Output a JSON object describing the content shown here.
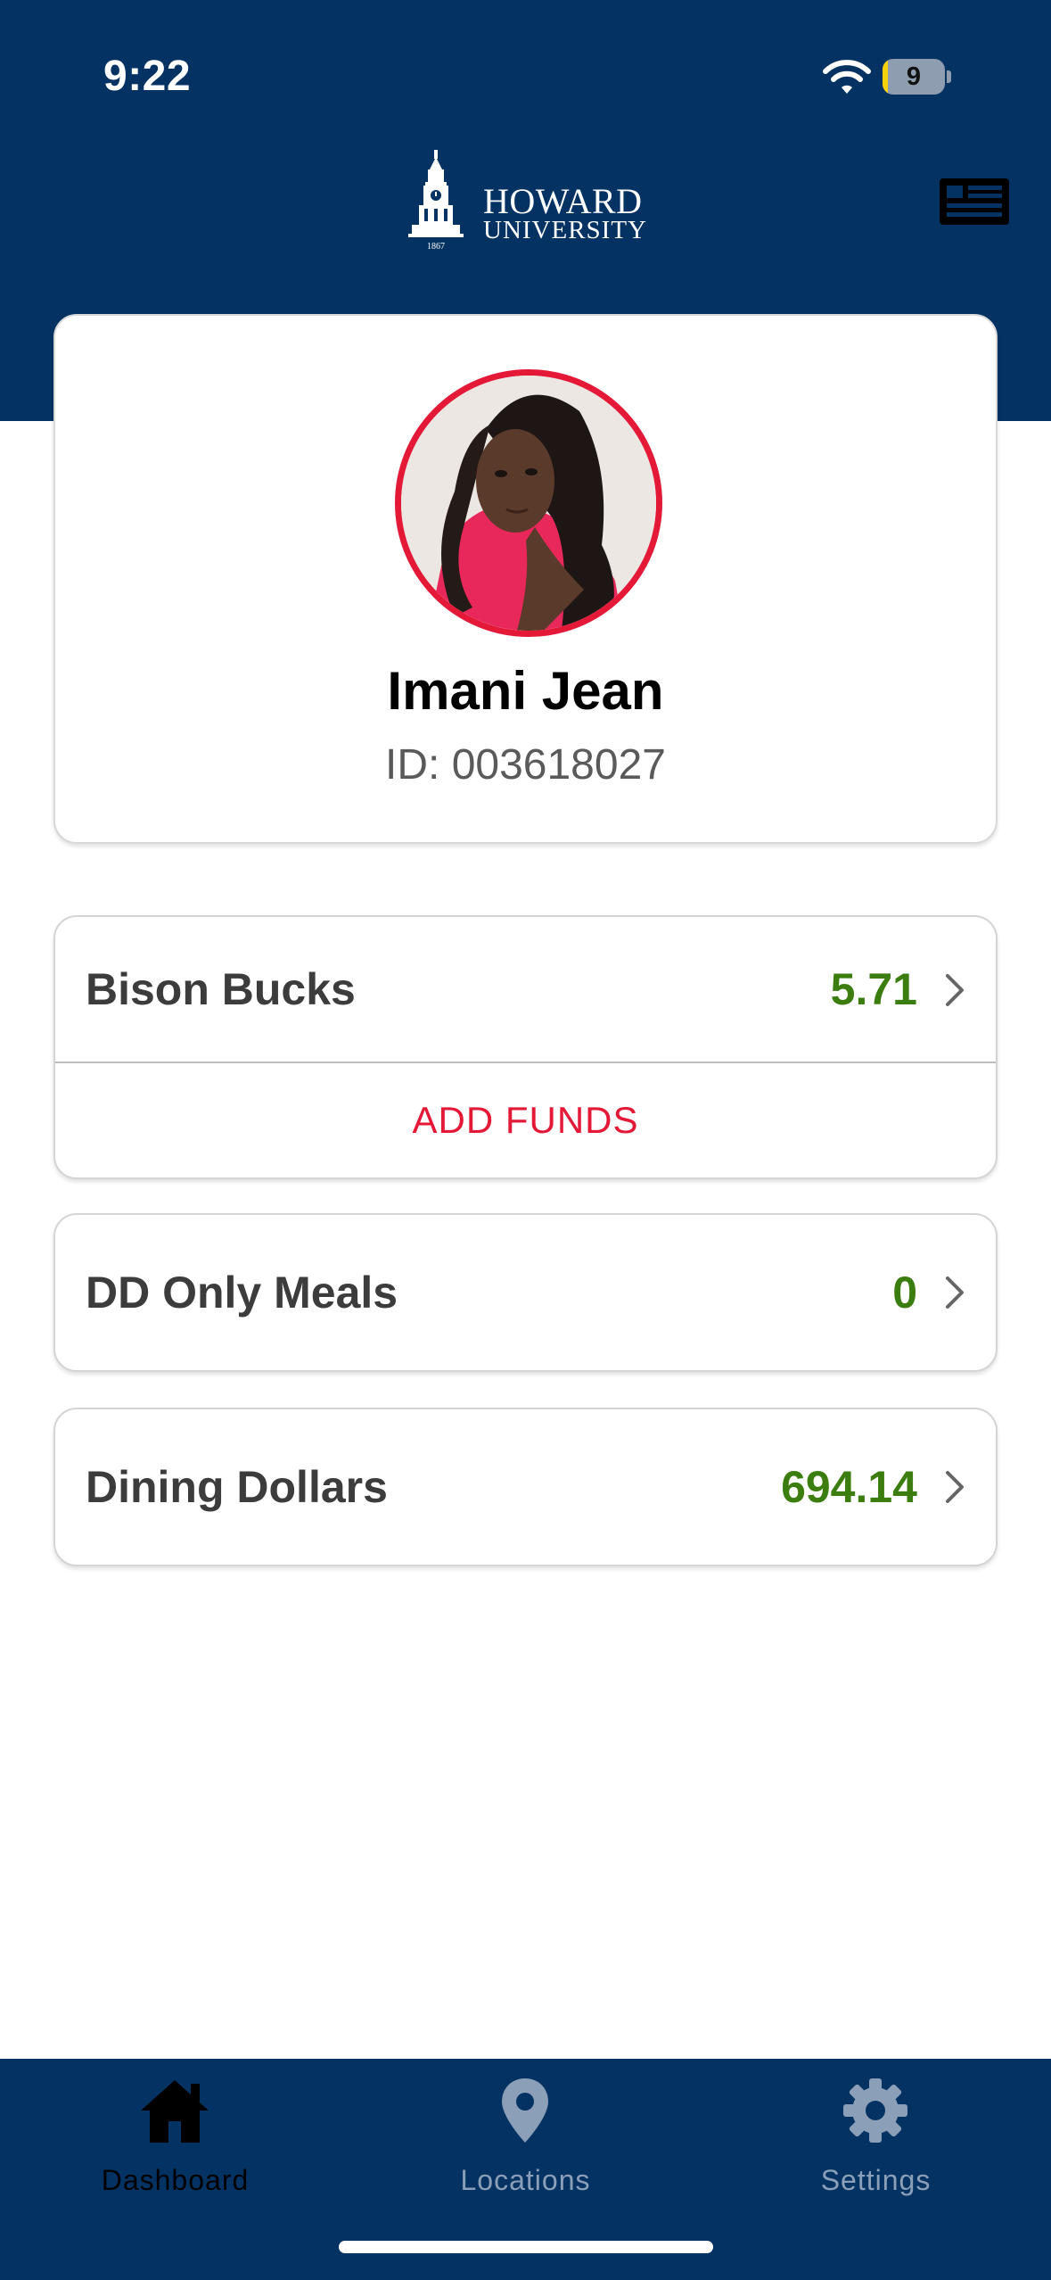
{
  "status_bar": {
    "time": "9:22",
    "battery_level": "9",
    "battery_fraction": 0.09
  },
  "header": {
    "logo_line1": "HOWARD",
    "logo_line2": "UNIVERSITY",
    "logo_year": "1867",
    "right_icon": "id-card-icon"
  },
  "profile": {
    "name": "Imani Jean",
    "id_label": "ID: 003618027",
    "avatar_ring_color": "#e31937"
  },
  "accounts": [
    {
      "label": "Bison Bucks",
      "value": "5.71",
      "action": "ADD FUNDS"
    },
    {
      "label": "DD Only Meals",
      "value": "0"
    },
    {
      "label": "Dining Dollars",
      "value": "694.14"
    }
  ],
  "tabbar": {
    "tabs": [
      {
        "label": "Dashboard",
        "icon": "home-icon",
        "active": true
      },
      {
        "label": "Locations",
        "icon": "map-pin-icon",
        "active": false
      },
      {
        "label": "Settings",
        "icon": "gear-icon",
        "active": false
      }
    ]
  },
  "colors": {
    "brand_navy": "#043363",
    "accent_red": "#e31937",
    "value_green": "#3c7d10",
    "tab_inactive": "#8b9fb8"
  }
}
